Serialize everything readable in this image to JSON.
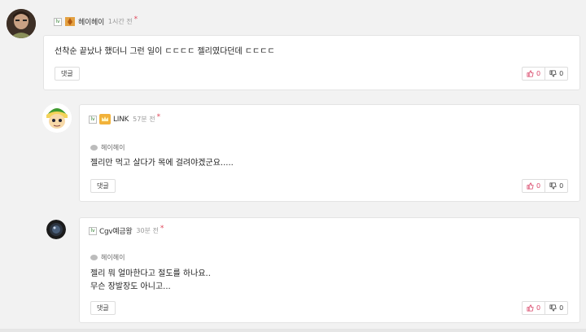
{
  "comments": [
    {
      "level_icon": "level-icon",
      "badge_icon": "flame-badge-icon",
      "nickname": "헤이헤이",
      "time": "1시간 전",
      "reply_to": "",
      "lines": [
        "선착순 끝났나 했더니 그런 일이 ㄷㄷㄷㄷ 젤리였다던데 ㄷㄷㄷㄷ"
      ],
      "reply_label": "댓글",
      "likes": "0",
      "dislikes": "0"
    },
    {
      "level_icon": "level-icon",
      "badge_icon": "crown-badge-icon",
      "nickname": "LINK",
      "time": "57분 전",
      "reply_to": "헤이헤이",
      "lines": [
        "젤리만 먹고 살다가 목에 걸려야겠군요....."
      ],
      "reply_label": "댓글",
      "likes": "0",
      "dislikes": "0"
    },
    {
      "level_icon": "level-icon",
      "badge_icon": "",
      "nickname": "Cgv예금왕",
      "time": "30분 전",
      "reply_to": "헤이헤이",
      "lines": [
        "젤리 뭐 얼마한다고 절도를 하나요..",
        "무슨 장발장도 아니고..."
      ],
      "reply_label": "댓글",
      "likes": "0",
      "dislikes": "0"
    }
  ],
  "colors": {
    "background": "#f2f2f2",
    "card": "#ffffff",
    "like": "#d9476a",
    "new_dot": "#e0475a"
  }
}
